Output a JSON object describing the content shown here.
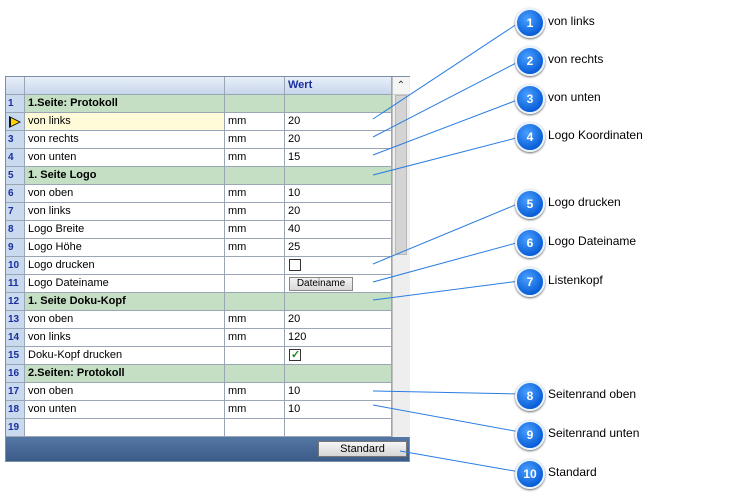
{
  "grid": {
    "header": {
      "num": "",
      "name": "",
      "unit": "",
      "value": "Wert"
    },
    "rows": [
      {
        "num": "1",
        "name": "1.Seite: Protokoll",
        "unit": "",
        "value": "",
        "type": "section"
      },
      {
        "num": "",
        "name": "von links",
        "unit": "mm",
        "value": "20",
        "type": "selected"
      },
      {
        "num": "3",
        "name": "von rechts",
        "unit": "mm",
        "value": "20",
        "type": "data"
      },
      {
        "num": "4",
        "name": "von unten",
        "unit": "mm",
        "value": "15",
        "type": "data"
      },
      {
        "num": "5",
        "name": "1. Seite Logo",
        "unit": "",
        "value": "",
        "type": "section"
      },
      {
        "num": "6",
        "name": "von oben",
        "unit": "mm",
        "value": "10",
        "type": "data"
      },
      {
        "num": "7",
        "name": "von links",
        "unit": "mm",
        "value": "20",
        "type": "data"
      },
      {
        "num": "8",
        "name": "Logo Breite",
        "unit": "mm",
        "value": "40",
        "type": "data"
      },
      {
        "num": "9",
        "name": "Logo Höhe",
        "unit": "mm",
        "value": "25",
        "type": "data"
      },
      {
        "num": "10",
        "name": "Logo drucken",
        "unit": "",
        "value": "",
        "type": "checkbox",
        "checked": false
      },
      {
        "num": "11",
        "name": "Logo Dateiname",
        "unit": "",
        "value": "Dateiname",
        "type": "button"
      },
      {
        "num": "12",
        "name": "1. Seite Doku-Kopf",
        "unit": "",
        "value": "",
        "type": "section"
      },
      {
        "num": "13",
        "name": "von oben",
        "unit": "mm",
        "value": "20",
        "type": "data"
      },
      {
        "num": "14",
        "name": "von links",
        "unit": "mm",
        "value": "120",
        "type": "data"
      },
      {
        "num": "15",
        "name": "Doku-Kopf drucken",
        "unit": "",
        "value": "",
        "type": "checkbox",
        "checked": true
      },
      {
        "num": "16",
        "name": "2.Seiten: Protokoll",
        "unit": "",
        "value": "",
        "type": "section"
      },
      {
        "num": "17",
        "name": "von oben",
        "unit": "mm",
        "value": "10",
        "type": "data"
      },
      {
        "num": "18",
        "name": "von unten",
        "unit": "mm",
        "value": "10",
        "type": "data"
      },
      {
        "num": "19",
        "name": "",
        "unit": "",
        "value": "",
        "type": "data"
      }
    ]
  },
  "footer": {
    "standard_label": "Standard"
  },
  "scrollbar": {
    "up_glyph": "⌃"
  },
  "callouts": [
    {
      "num": "1",
      "label": "von links"
    },
    {
      "num": "2",
      "label": "von rechts"
    },
    {
      "num": "3",
      "label": "von unten"
    },
    {
      "num": "4",
      "label": "Logo Koordinaten"
    },
    {
      "num": "5",
      "label": "Logo drucken"
    },
    {
      "num": "6",
      "label": "Logo Dateiname"
    },
    {
      "num": "7",
      "label": "Listenkopf"
    },
    {
      "num": "8",
      "label": "Seitenrand oben"
    },
    {
      "num": "9",
      "label": "Seitenrand unten"
    },
    {
      "num": "10",
      "label": "Standard"
    }
  ],
  "colors": {
    "badge": "#1a73e8",
    "section": "#c4dfc4",
    "footer": "#3b5b89",
    "header_text": "#1b2f9e",
    "line": "#2a7de1"
  }
}
